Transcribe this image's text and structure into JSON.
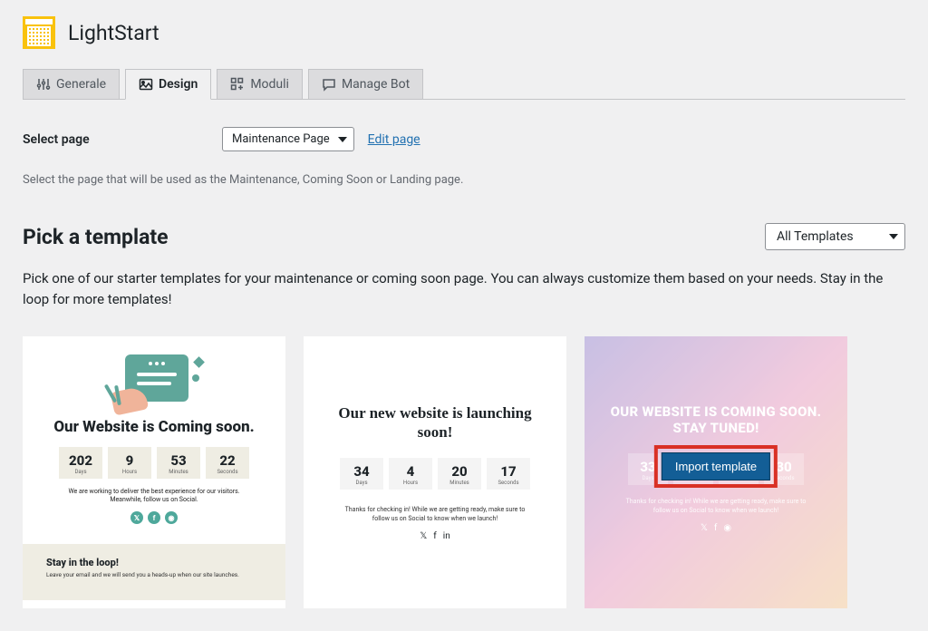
{
  "header": {
    "app_name": "LightStart"
  },
  "tabs": {
    "generale": "Generale",
    "design": "Design",
    "moduli": "Moduli",
    "manage_bot": "Manage Bot"
  },
  "select_page": {
    "label": "Select page",
    "value": "Maintenance Page",
    "edit_link": "Edit page",
    "helper": "Select the page that will be used as the Maintenance, Coming Soon or Landing page."
  },
  "pick_template": {
    "title": "Pick a template",
    "filter": "All Templates",
    "description": "Pick one of our starter templates for your maintenance or coming soon page. You can always customize them based on your needs. Stay in the loop for more templates!"
  },
  "templates": {
    "t1": {
      "title": "Our Website is Coming soon.",
      "counters": [
        {
          "num": "202",
          "label": "Days"
        },
        {
          "num": "9",
          "label": "Hours"
        },
        {
          "num": "53",
          "label": "Minutes"
        },
        {
          "num": "22",
          "label": "Seconds"
        }
      ],
      "text": "We are working to deliver the best experience for our visitors. Meanwhile, follow us on Social.",
      "footer_title": "Stay in the loop!",
      "footer_text": "Leave your email and we will send you a heads-up when our site launches."
    },
    "t2": {
      "title": "Our new website is launching soon!",
      "counters": [
        {
          "num": "34",
          "label": "Days"
        },
        {
          "num": "4",
          "label": "Hours"
        },
        {
          "num": "20",
          "label": "Minutes"
        },
        {
          "num": "17",
          "label": "Seconds"
        }
      ],
      "text": "Thanks for checking in! While we are getting ready, make sure to follow us on Social to know when we launch!"
    },
    "t3": {
      "title": "OUR WEBSITE IS COMING SOON. STAY TUNED!",
      "counters": [
        {
          "num": "33",
          "label": "Days"
        },
        {
          "num": "",
          "label": ""
        },
        {
          "num": "",
          "label": ""
        },
        {
          "num": "30",
          "label": "Seconds"
        }
      ],
      "text": "Thanks for checking in! While we are getting ready, make sure to follow us on Social to know when we launch!",
      "import_button": "Import template"
    }
  }
}
